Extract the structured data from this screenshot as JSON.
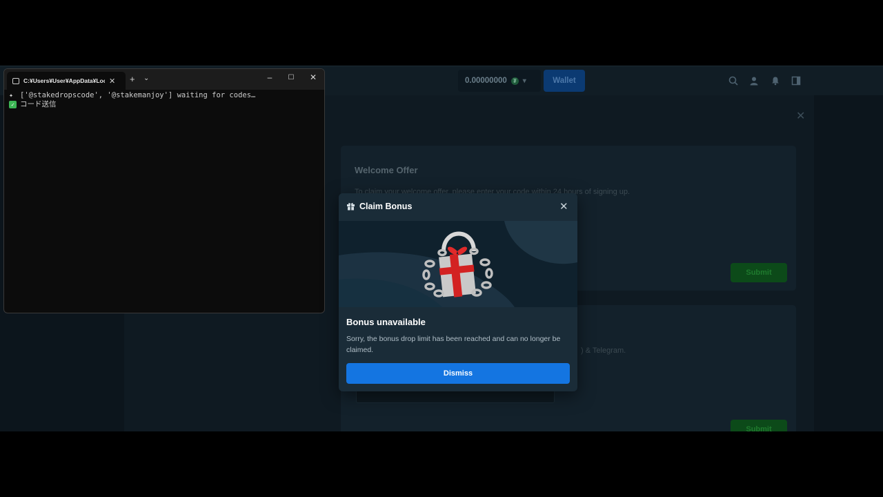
{
  "terminal": {
    "tab_title": "C:¥Users¥User¥AppData¥Loca",
    "lines": [
      "['@stakedropscode', '@stakemanjoy'] waiting for codes…",
      "コード送信"
    ]
  },
  "site": {
    "balance": "0.00000000",
    "wallet_label": "Wallet",
    "welcome_title": "Welcome Offer",
    "welcome_text": "To claim your welcome offer, please enter your code within 24 hours of signing up.",
    "submit_label": "Submit",
    "second_text": ") & Telegram."
  },
  "modal": {
    "title": "Claim Bonus",
    "heading": "Bonus unavailable",
    "message": "Sorry, the bonus drop limit has been reached and can no longer be claimed.",
    "dismiss_label": "Dismiss"
  }
}
